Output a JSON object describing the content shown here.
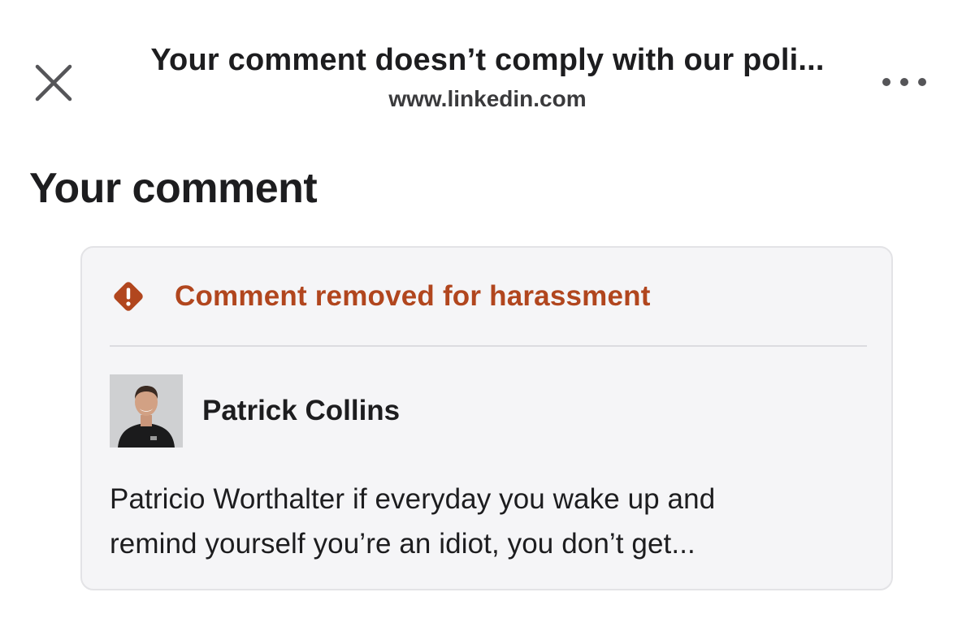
{
  "header": {
    "title": "Your comment doesn’t comply with our poli...",
    "url": "www.linkedin.com",
    "close_icon": "close-icon",
    "more_icon": "more-horizontal-icon"
  },
  "section": {
    "heading": "Your comment"
  },
  "card": {
    "status_icon": "warning-diamond-icon",
    "status_text": "Comment removed for harassment",
    "status_color": "#b1461e",
    "author": {
      "name": "Patrick Collins",
      "avatar_icon": "avatar"
    },
    "comment_lines": [
      "Patricio Worthalter if everyday you wake up and",
      "remind yourself you’re an idiot, you don’t get..."
    ]
  },
  "colors": {
    "background": "#ffffff",
    "card_background": "#f5f5f7",
    "text": "#1d1d1f"
  }
}
